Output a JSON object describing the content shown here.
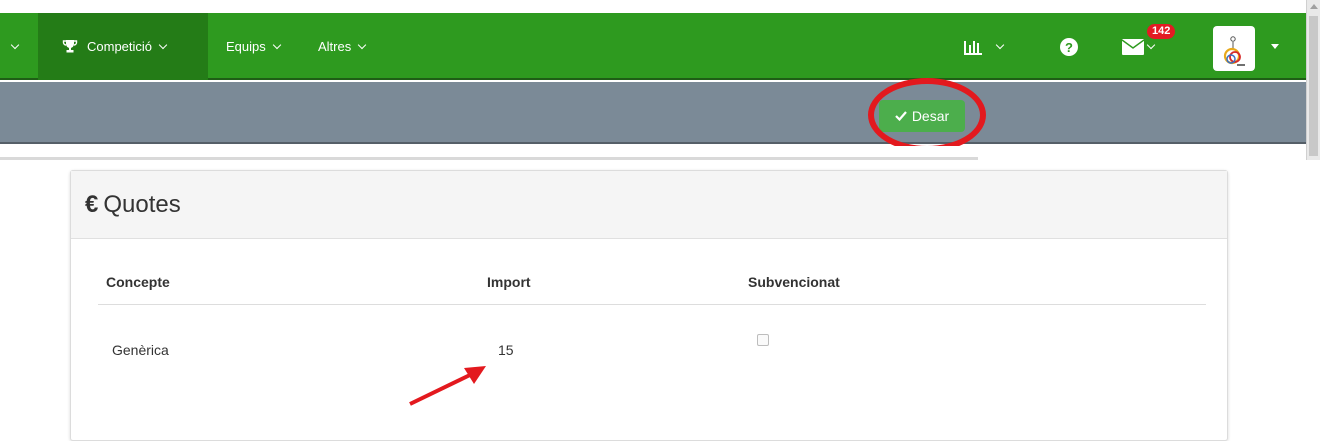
{
  "nav": {
    "menus": [
      {
        "label": "Competició",
        "icon": "trophy-icon",
        "active": true
      },
      {
        "label": "Equips",
        "active": false
      },
      {
        "label": "Altres",
        "active": false
      }
    ],
    "messages_badge": "142"
  },
  "toolbar": {
    "save_label": "Desar"
  },
  "panel": {
    "title": "Quotes",
    "currency_symbol": "€",
    "columns": [
      "Concepte",
      "Import",
      "Subvencionat"
    ],
    "rows": [
      {
        "concept": "Genèrica",
        "amount": "15",
        "subsidized": false
      }
    ]
  },
  "colors": {
    "nav_bg": "#2e9a1f",
    "toolbar_bg": "#7b8a97",
    "save_button": "#4cae4c",
    "annotation_red": "#e3191e"
  }
}
